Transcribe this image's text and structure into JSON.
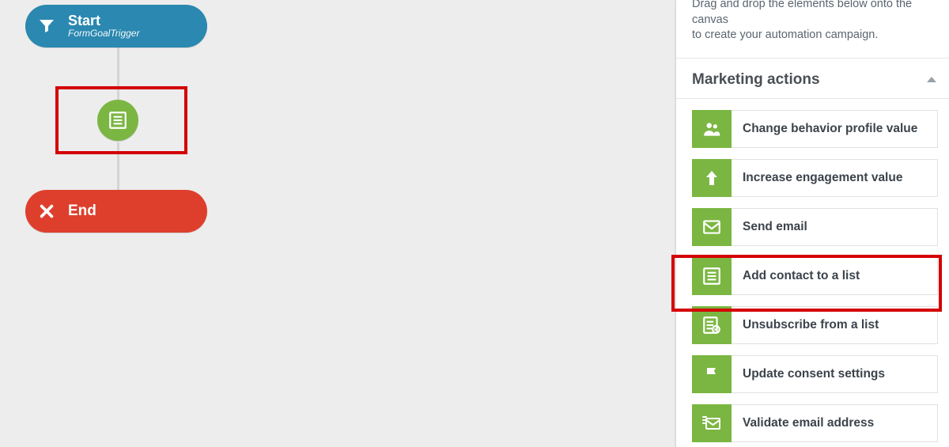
{
  "canvas": {
    "start": {
      "title": "Start",
      "subtitle": "FormGoalTrigger"
    },
    "end": {
      "title": "End"
    }
  },
  "panel": {
    "description_l1": "Drag and drop the elements below onto the canvas",
    "description_l2": "to create your automation campaign.",
    "section_title": "Marketing actions",
    "actions": [
      {
        "label": "Change behavior profile value"
      },
      {
        "label": "Increase engagement value"
      },
      {
        "label": "Send email"
      },
      {
        "label": "Add contact to a list"
      },
      {
        "label": "Unsubscribe from a list"
      },
      {
        "label": "Update consent settings"
      },
      {
        "label": "Validate email address"
      }
    ]
  },
  "colors": {
    "start": "#2b88b0",
    "end": "#de3f2c",
    "action": "#7bb642",
    "highlight": "#d40000"
  }
}
